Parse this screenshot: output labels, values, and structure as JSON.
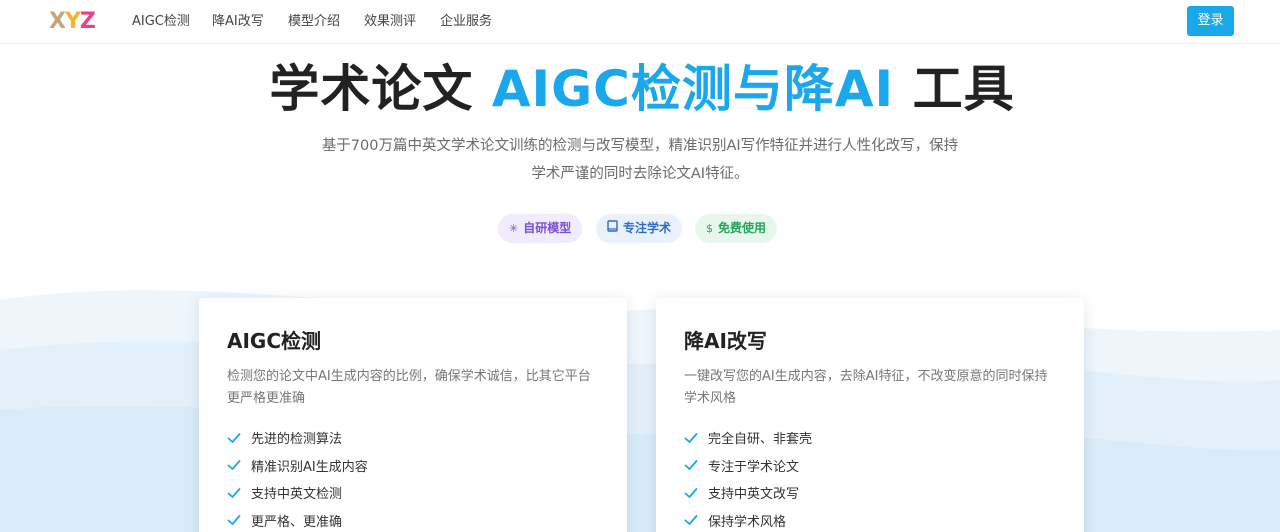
{
  "nav": {
    "logo": {
      "x": "X",
      "y": "Y",
      "z": "Z"
    },
    "items": [
      "AIGC检测",
      "降AI改写",
      "模型介绍",
      "效果测评",
      "企业服务"
    ],
    "login": "登录"
  },
  "hero": {
    "title_pre": "学术论文 ",
    "title_accent": "AIGC检测与降AI",
    "title_post": " 工具",
    "subtitle_line1": "基于700万篇中英文学术论文训练的检测与改写模型，精准识别AI写作特征并进行人性化改写，保持",
    "subtitle_line2": "学术严谨的同时去除论文AI特征。",
    "badges": [
      {
        "icon": "sparkle-icon",
        "label": "自研模型"
      },
      {
        "icon": "book-icon",
        "label": "专注学术"
      },
      {
        "icon": "dollar-icon",
        "label": "免费使用"
      }
    ]
  },
  "cards": [
    {
      "title": "AIGC检测",
      "desc": "检测您的论文中AI生成内容的比例，确保学术诚信，比其它平台更严格更准确",
      "features": [
        "先进的检测算法",
        "精准识别AI生成内容",
        "支持中英文检测",
        "更严格、更准确"
      ]
    },
    {
      "title": "降AI改写",
      "desc": "一键改写您的AI生成内容，去除AI特征，不改变原意的同时保持学术风格",
      "features": [
        "完全自研、非套壳",
        "专注于学术论文",
        "支持中英文改写",
        "保持学术风格"
      ]
    }
  ],
  "colors": {
    "accent": "#1aa7ec",
    "check": "#1aa7ec",
    "badge_purple": "#7b4fd8",
    "badge_blue": "#2e6cc2",
    "badge_green": "#26a656"
  }
}
